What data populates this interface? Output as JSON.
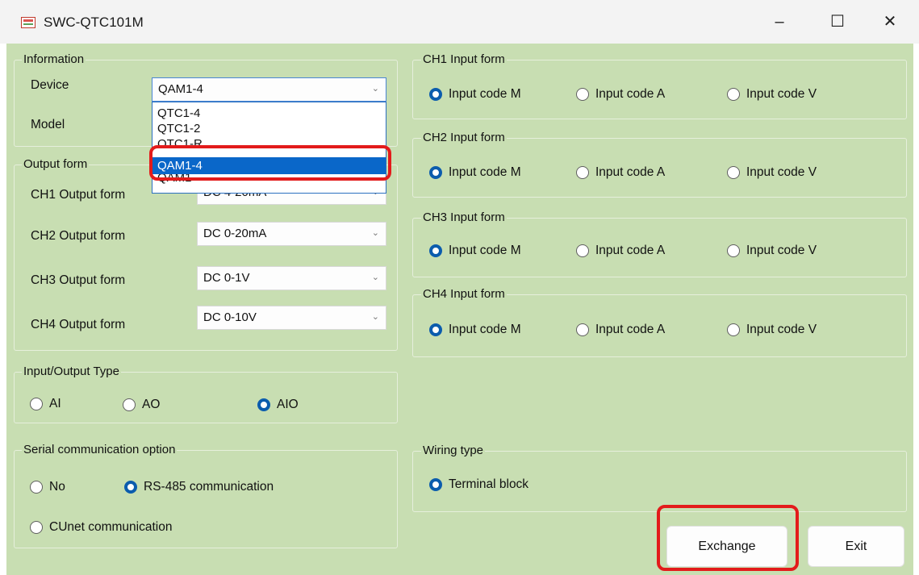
{
  "window": {
    "title": "SWC-QTC101M",
    "icon": "app-icon",
    "controls": [
      "–",
      "☐",
      "✕"
    ]
  },
  "information": {
    "group_label": "Information",
    "device_label": "Device",
    "device_value": "QAM1-4",
    "model_label": "Model",
    "device_options": [
      "QTC1-4",
      "QTC1-2",
      "QTC1-R",
      "QAM1-4",
      "QAM1"
    ],
    "selected_option": "QAM1-4"
  },
  "output_form": {
    "group_label": "Output form",
    "rows": [
      {
        "label": "CH1 Output form",
        "value": "DC 4-20mA"
      },
      {
        "label": "CH2 Output form",
        "value": "DC 0-20mA"
      },
      {
        "label": "CH3 Output form",
        "value": "DC 0-1V"
      },
      {
        "label": "CH4 Output form",
        "value": "DC 0-10V"
      }
    ]
  },
  "input_forms": [
    {
      "group_label": "CH1 Input form",
      "options": [
        "Input code M",
        "Input code A",
        "Input code V"
      ],
      "selected": "Input code M"
    },
    {
      "group_label": "CH2 Input form",
      "options": [
        "Input code M",
        "Input code A",
        "Input code V"
      ],
      "selected": "Input code M"
    },
    {
      "group_label": "CH3 Input form",
      "options": [
        "Input code M",
        "Input code A",
        "Input code V"
      ],
      "selected": "Input code M"
    },
    {
      "group_label": "CH4 Input form",
      "options": [
        "Input code M",
        "Input code A",
        "Input code V"
      ],
      "selected": "Input code M"
    }
  ],
  "io_type": {
    "group_label": "Input/Output Type",
    "options": [
      "AI",
      "AO",
      "AIO"
    ],
    "selected": "AIO"
  },
  "serial": {
    "group_label": "Serial communication option",
    "options": [
      "No",
      "RS-485 communication",
      "CUnet communication"
    ],
    "selected": "RS-485 communication"
  },
  "wiring": {
    "group_label": "Wiring type",
    "option": "Terminal block",
    "selected": true
  },
  "buttons": {
    "exchange": "Exchange",
    "exit": "Exit"
  },
  "colors": {
    "background": "#c8deb2",
    "accent": "#0b5cad",
    "highlight": "#e31b1b",
    "selection": "#0a67c9"
  }
}
